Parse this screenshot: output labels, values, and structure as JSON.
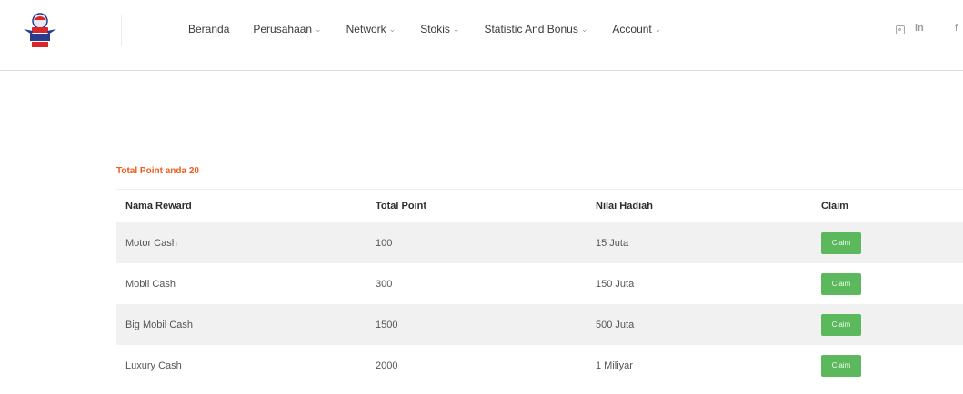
{
  "header": {
    "logo_icon": "company-logo-icon",
    "nav": [
      {
        "label": "Beranda",
        "dropdown": false
      },
      {
        "label": "Perusahaan",
        "dropdown": true
      },
      {
        "label": "Network",
        "dropdown": true
      },
      {
        "label": "Stokis",
        "dropdown": true
      },
      {
        "label": "Statistic And Bonus",
        "dropdown": true
      },
      {
        "label": "Account",
        "dropdown": true
      }
    ],
    "social": {
      "instagram_icon": "instagram-icon",
      "linkedin_label": "in",
      "facebook_label": "f"
    }
  },
  "main": {
    "total_point_text": "Total Point anda 20",
    "table": {
      "headers": [
        "Nama Reward",
        "Total Point",
        "Nilai Hadiah",
        "Claim"
      ],
      "rows": [
        {
          "name": "Motor Cash",
          "total_point": "100",
          "value": "15 Juta",
          "button": "Claim"
        },
        {
          "name": "Mobil Cash",
          "total_point": "300",
          "value": "150 Juta",
          "button": "Claim"
        },
        {
          "name": "Big Mobil Cash",
          "total_point": "1500",
          "value": "500 Juta",
          "button": "Claim"
        },
        {
          "name": "Luxury Cash",
          "total_point": "2000",
          "value": "1 Miliyar",
          "button": "Claim"
        }
      ]
    }
  },
  "colors": {
    "accent": "#f05a1a",
    "claim_button": "#5cb85c",
    "stripe": "#f1f1f1"
  }
}
